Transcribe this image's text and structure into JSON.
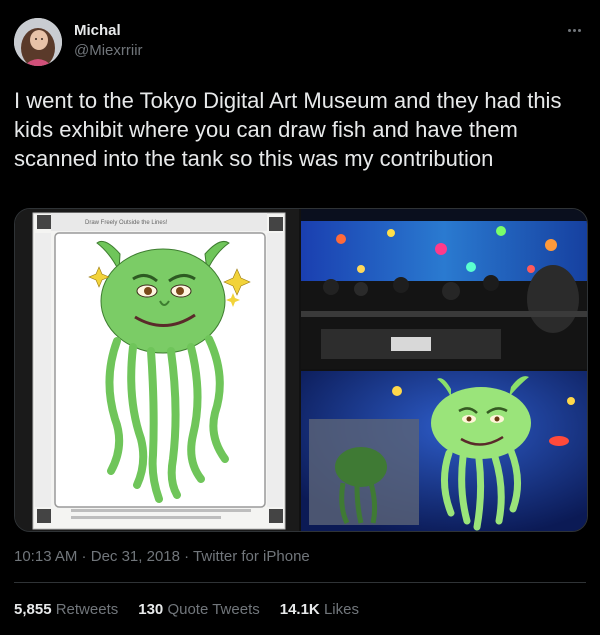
{
  "author": {
    "name": "Michal",
    "handle": "@Miexrriir"
  },
  "tweet": {
    "text": "I went to the Tokyo Digital Art Museum and they had this kids exhibit where you can draw fish and have them scanned into the tank so this was my contribution"
  },
  "media": {
    "photo1": {
      "subject": "hand-drawn green jellyfish with Shrek face on coloring sheet",
      "sheet_header": "Draw Freely Outside the Lines!"
    },
    "photo2": {
      "subject": "dark museum room with projected underwater aquarium wall and visitors at tables"
    },
    "photo3": {
      "subject": "scanned Shrek jellyfish projected swimming on digital tank wall"
    }
  },
  "meta": {
    "time": "10:13 AM",
    "separator1": " · ",
    "date": "Dec 31, 2018",
    "separator2": " · ",
    "source": "Twitter for iPhone"
  },
  "stats": {
    "retweets_count": "5,855",
    "retweets_label": "Retweets",
    "quotes_count": "130",
    "quotes_label": "Quote Tweets",
    "likes_count": "14.1K",
    "likes_label": "Likes"
  },
  "colors": {
    "background": "#000000",
    "text_primary": "#e7e9ea",
    "text_secondary": "#71767b",
    "border": "#2f3336",
    "jellyfish_green": "#6fc55a"
  }
}
